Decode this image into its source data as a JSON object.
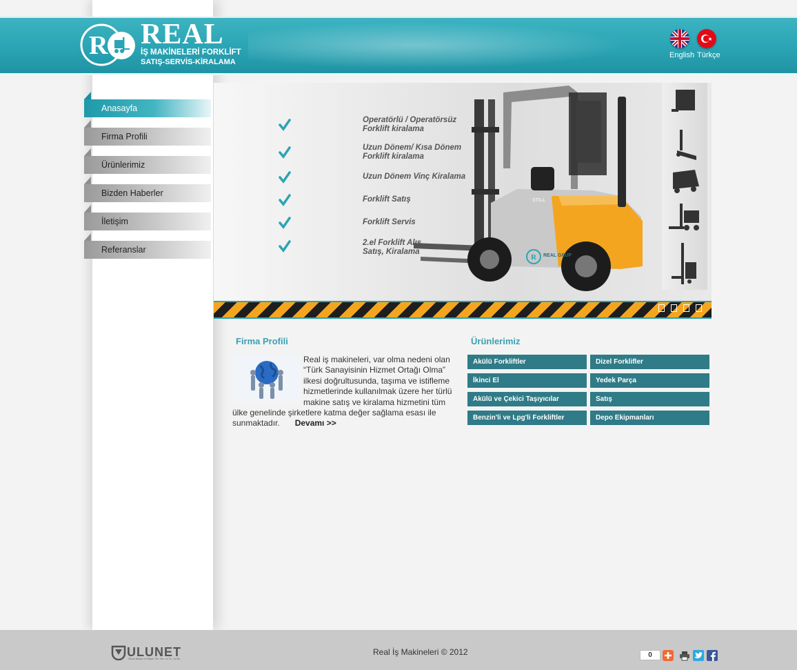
{
  "header": {
    "logo_word": "REAL",
    "logo_line1": "İŞ MAKİNELERİ FORKLİFT",
    "logo_line2": "SATIŞ-SERVİS-KİRALAMA",
    "languages": [
      {
        "label": "English",
        "icon": "uk-flag-icon"
      },
      {
        "label": "Türkçe",
        "icon": "turkey-flag-icon"
      }
    ]
  },
  "nav": {
    "items": [
      {
        "label": "Anasayfa",
        "active": true
      },
      {
        "label": "Firma Profili",
        "active": false
      },
      {
        "label": "Ürünlerimiz",
        "active": false
      },
      {
        "label": "Bizden Haberler",
        "active": false
      },
      {
        "label": "İletişim",
        "active": false
      },
      {
        "label": "Referanslar",
        "active": false
      }
    ]
  },
  "banner": {
    "features": [
      {
        "line1": "Operatörlü / Operatörsüz",
        "line2": "Forklift   kiralama"
      },
      {
        "line1": "Uzun Dönem/ Kısa Dönem",
        "line2": "Forklift   kiralama"
      },
      {
        "line1": "Uzun Dönem Vinç Kiralama",
        "line2": ""
      },
      {
        "line1": "Forklift  Satış",
        "line2": ""
      },
      {
        "line1": "Forklift  Servis",
        "line2": ""
      },
      {
        "line1": "2.el Forklift Alış,",
        "line2": "Satış, Kiralama"
      }
    ],
    "forklift_brand": "STILL",
    "forklift_decal": "REAL GRUP",
    "slide_count": 4,
    "colors": {
      "accent": "#2aa4b4",
      "forklift": "#f4a51f"
    }
  },
  "profile": {
    "title": "Firma Profili",
    "text": " Real iş makineleri, var olma nedeni olan “Türk Sanayisinin Hizmet Ortağı Olma” ilkesi doğrultusunda, taşıma ve istifleme hizmetlerinde kullanılmak üzere her türlü makine satış ve kiralama hizmetini tüm ülke genelinde şirketlere katma değer sağlama esası ile sunmaktadır.",
    "more": "Devamı >>"
  },
  "products": {
    "title": "Ürünlerimiz",
    "items": [
      "Akülü Forkliftler",
      "Dizel Forklifler",
      "İkinci El",
      "Yedek Parça",
      "Akülü ve Çekici Taşıyıcılar",
      "Satış",
      "Benzin'li ve Lpg'li Forkliftler",
      "Depo Ekipmanları"
    ],
    "button_color": "#2f7b87"
  },
  "footer": {
    "brand": "ULUNET",
    "brand_sub": "Ulusal İletişim ve Bilişim Tek. San. ve Tic. Ltd.Şti.",
    "copyright": "Real İş Makineleri © 2012",
    "share_count": "0"
  }
}
